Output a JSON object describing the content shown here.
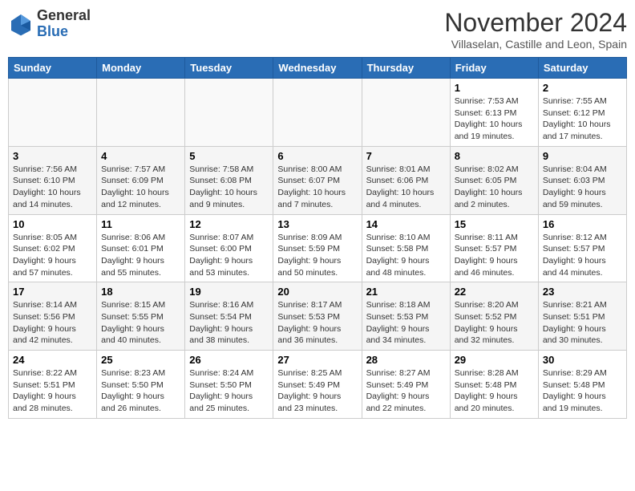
{
  "header": {
    "logo_general": "General",
    "logo_blue": "Blue",
    "month_title": "November 2024",
    "location": "Villaselan, Castille and Leon, Spain"
  },
  "weekdays": [
    "Sunday",
    "Monday",
    "Tuesday",
    "Wednesday",
    "Thursday",
    "Friday",
    "Saturday"
  ],
  "weeks": [
    [
      {
        "day": "",
        "info": ""
      },
      {
        "day": "",
        "info": ""
      },
      {
        "day": "",
        "info": ""
      },
      {
        "day": "",
        "info": ""
      },
      {
        "day": "",
        "info": ""
      },
      {
        "day": "1",
        "info": "Sunrise: 7:53 AM\nSunset: 6:13 PM\nDaylight: 10 hours and 19 minutes."
      },
      {
        "day": "2",
        "info": "Sunrise: 7:55 AM\nSunset: 6:12 PM\nDaylight: 10 hours and 17 minutes."
      }
    ],
    [
      {
        "day": "3",
        "info": "Sunrise: 7:56 AM\nSunset: 6:10 PM\nDaylight: 10 hours and 14 minutes."
      },
      {
        "day": "4",
        "info": "Sunrise: 7:57 AM\nSunset: 6:09 PM\nDaylight: 10 hours and 12 minutes."
      },
      {
        "day": "5",
        "info": "Sunrise: 7:58 AM\nSunset: 6:08 PM\nDaylight: 10 hours and 9 minutes."
      },
      {
        "day": "6",
        "info": "Sunrise: 8:00 AM\nSunset: 6:07 PM\nDaylight: 10 hours and 7 minutes."
      },
      {
        "day": "7",
        "info": "Sunrise: 8:01 AM\nSunset: 6:06 PM\nDaylight: 10 hours and 4 minutes."
      },
      {
        "day": "8",
        "info": "Sunrise: 8:02 AM\nSunset: 6:05 PM\nDaylight: 10 hours and 2 minutes."
      },
      {
        "day": "9",
        "info": "Sunrise: 8:04 AM\nSunset: 6:03 PM\nDaylight: 9 hours and 59 minutes."
      }
    ],
    [
      {
        "day": "10",
        "info": "Sunrise: 8:05 AM\nSunset: 6:02 PM\nDaylight: 9 hours and 57 minutes."
      },
      {
        "day": "11",
        "info": "Sunrise: 8:06 AM\nSunset: 6:01 PM\nDaylight: 9 hours and 55 minutes."
      },
      {
        "day": "12",
        "info": "Sunrise: 8:07 AM\nSunset: 6:00 PM\nDaylight: 9 hours and 53 minutes."
      },
      {
        "day": "13",
        "info": "Sunrise: 8:09 AM\nSunset: 5:59 PM\nDaylight: 9 hours and 50 minutes."
      },
      {
        "day": "14",
        "info": "Sunrise: 8:10 AM\nSunset: 5:58 PM\nDaylight: 9 hours and 48 minutes."
      },
      {
        "day": "15",
        "info": "Sunrise: 8:11 AM\nSunset: 5:57 PM\nDaylight: 9 hours and 46 minutes."
      },
      {
        "day": "16",
        "info": "Sunrise: 8:12 AM\nSunset: 5:57 PM\nDaylight: 9 hours and 44 minutes."
      }
    ],
    [
      {
        "day": "17",
        "info": "Sunrise: 8:14 AM\nSunset: 5:56 PM\nDaylight: 9 hours and 42 minutes."
      },
      {
        "day": "18",
        "info": "Sunrise: 8:15 AM\nSunset: 5:55 PM\nDaylight: 9 hours and 40 minutes."
      },
      {
        "day": "19",
        "info": "Sunrise: 8:16 AM\nSunset: 5:54 PM\nDaylight: 9 hours and 38 minutes."
      },
      {
        "day": "20",
        "info": "Sunrise: 8:17 AM\nSunset: 5:53 PM\nDaylight: 9 hours and 36 minutes."
      },
      {
        "day": "21",
        "info": "Sunrise: 8:18 AM\nSunset: 5:53 PM\nDaylight: 9 hours and 34 minutes."
      },
      {
        "day": "22",
        "info": "Sunrise: 8:20 AM\nSunset: 5:52 PM\nDaylight: 9 hours and 32 minutes."
      },
      {
        "day": "23",
        "info": "Sunrise: 8:21 AM\nSunset: 5:51 PM\nDaylight: 9 hours and 30 minutes."
      }
    ],
    [
      {
        "day": "24",
        "info": "Sunrise: 8:22 AM\nSunset: 5:51 PM\nDaylight: 9 hours and 28 minutes."
      },
      {
        "day": "25",
        "info": "Sunrise: 8:23 AM\nSunset: 5:50 PM\nDaylight: 9 hours and 26 minutes."
      },
      {
        "day": "26",
        "info": "Sunrise: 8:24 AM\nSunset: 5:50 PM\nDaylight: 9 hours and 25 minutes."
      },
      {
        "day": "27",
        "info": "Sunrise: 8:25 AM\nSunset: 5:49 PM\nDaylight: 9 hours and 23 minutes."
      },
      {
        "day": "28",
        "info": "Sunrise: 8:27 AM\nSunset: 5:49 PM\nDaylight: 9 hours and 22 minutes."
      },
      {
        "day": "29",
        "info": "Sunrise: 8:28 AM\nSunset: 5:48 PM\nDaylight: 9 hours and 20 minutes."
      },
      {
        "day": "30",
        "info": "Sunrise: 8:29 AM\nSunset: 5:48 PM\nDaylight: 9 hours and 19 minutes."
      }
    ]
  ]
}
